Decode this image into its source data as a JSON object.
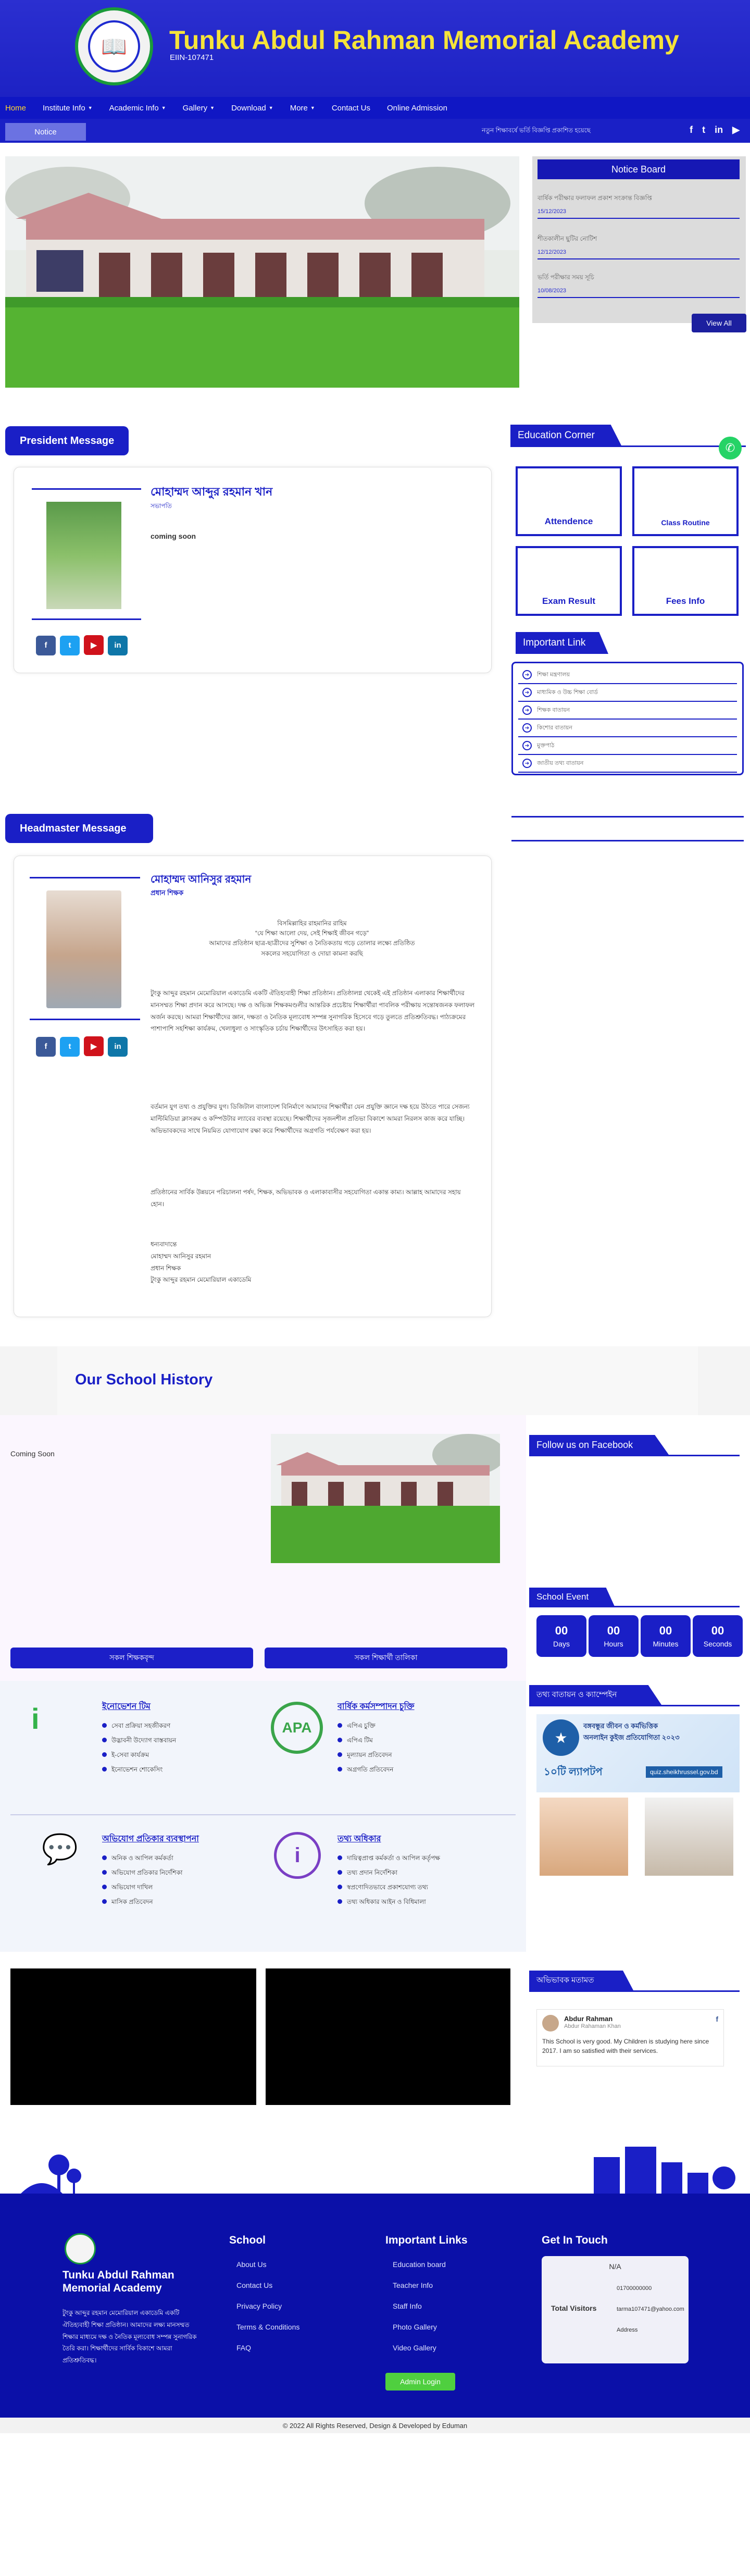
{
  "header": {
    "title": "Tunku Abdul Rahman Memorial Academy",
    "eiin": "EIIN-107471",
    "logo_text": "TUNKU ABDUL RAHMAN MEMORIAL ACADEMY"
  },
  "nav": {
    "items": [
      {
        "label": "Home",
        "active": true,
        "dropdown": false
      },
      {
        "label": "Institute Info",
        "dropdown": true
      },
      {
        "label": "Academic Info",
        "dropdown": true
      },
      {
        "label": "Gallery",
        "dropdown": true
      },
      {
        "label": "Download",
        "dropdown": true
      },
      {
        "label": "More",
        "dropdown": true
      },
      {
        "label": "Contact Us",
        "dropdown": false
      },
      {
        "label": "Online Admission",
        "dropdown": false
      }
    ]
  },
  "notice_bar": {
    "label": "Notice",
    "ticker": "নতুন শিক্ষাবর্ষে ভর্তি বিজ্ঞপ্তি প্রকাশিত হয়েছে",
    "social": [
      "f",
      "t",
      "in",
      "▶"
    ]
  },
  "notice_board": {
    "title": "Notice Board",
    "items": [
      {
        "text": "বার্ষিক পরীক্ষার ফলাফল প্রকাশ সংক্রান্ত বিজ্ঞপ্তি",
        "date": "15/12/2023"
      },
      {
        "text": "শীতকালীন ছুটির নোটিশ",
        "date": "12/12/2023"
      },
      {
        "text": "ভর্তি পরীক্ষার সময় সূচি",
        "date": "10/08/2023"
      }
    ],
    "view_all": "View All"
  },
  "president": {
    "heading": "President Message",
    "name": "মোহাম্মদ আব্দুর রহমান খান",
    "role": "সভাপতি",
    "message": "coming soon"
  },
  "education_corner": {
    "title": "Education Corner",
    "boxes": [
      "Attendence",
      "Class Routine",
      "Exam Result",
      "Fees Info"
    ]
  },
  "important_link": {
    "title": "Important Link",
    "items": [
      "শিক্ষা মন্ত্রণালয়",
      "মাধ্যমিক ও উচ্চ শিক্ষা বোর্ড",
      "শিক্ষক বাতায়ন",
      "কিশোর বাতায়ন",
      "মুক্তপাঠ",
      "জাতীয় তথ্য বাতায়ন"
    ]
  },
  "headmaster": {
    "heading": "Headmaster Message",
    "name": "মোহাম্মদ আনিসুর রহমান",
    "role": "প্রধান শিক্ষক",
    "greet1": "বিসমিল্লাহির রাহমানির রাহিম",
    "greet2": "“যে শিক্ষা আলো দেয়, সেই শিক্ষাই জীবন গড়ে”",
    "greet3": "আমাদের প্রতিষ্ঠান ছাত্র-ছাত্রীদের সুশিক্ষা ও নৈতিকতায় গড়ে তোলার লক্ষ্যে প্রতিষ্ঠিত",
    "greet4": "সকলের সহযোগিতা ও দোয়া কামনা করছি",
    "p1": "টুংকু আব্দুর রহমান মেমোরিয়াল একাডেমি একটি ঐতিহ্যবাহী শিক্ষা প্রতিষ্ঠান। প্রতিষ্ঠালগ্ন থেকেই এই প্রতিষ্ঠান এলাকার শিক্ষার্থীদের মানসম্মত শিক্ষা প্রদান করে আসছে। দক্ষ ও অভিজ্ঞ শিক্ষকমণ্ডলীর আন্তরিক প্রচেষ্টায় শিক্ষার্থীরা পাবলিক পরীক্ষায় সন্তোষজনক ফলাফল অর্জন করছে। আমরা শিক্ষার্থীদের জ্ঞান, দক্ষতা ও নৈতিক মূল্যবোধ সম্পন্ন সুনাগরিক হিসেবে গড়ে তুলতে প্রতিশ্রুতিবদ্ধ। পাঠ্যক্রমের পাশাপাশি সহশিক্ষা কার্যক্রম, খেলাধুলা ও সাংস্কৃতিক চর্চায় শিক্ষার্থীদের উৎসাহিত করা হয়।",
    "p2": "বর্তমান যুগ তথ্য ও প্রযুক্তির যুগ। ডিজিটাল বাংলাদেশ বিনির্মাণে আমাদের শিক্ষার্থীরা যেন প্রযুক্তি জ্ঞানে দক্ষ হয়ে উঠতে পারে সেজন্য মাল্টিমিডিয়া ক্লাসরুম ও কম্পিউটার ল্যাবের ব্যবস্থা রয়েছে। শিক্ষার্থীদের সৃজনশীল প্রতিভা বিকাশে আমরা নিরলস কাজ করে যাচ্ছি। অভিভাবকদের সাথে নিয়মিত যোগাযোগ রক্ষা করে শিক্ষার্থীদের অগ্রগতি পর্যবেক্ষণ করা হয়।",
    "p3": "প্রতিষ্ঠানের সার্বিক উন্নয়নে পরিচালনা পর্ষদ, শিক্ষক, অভিভাবক ও এলাকাবাসীর সহযোগিতা একান্ত কাম্য। আল্লাহ আমাদের সহায় হোন।",
    "sign1": "ধন্যবাদান্তে",
    "sign2": "মোহাম্মদ আনিসুর রহমান",
    "sign3": "প্রধান শিক্ষক",
    "sign4": "টুংকু আব্দুর রহমান মেমোরিয়াল একাডেমি"
  },
  "history": {
    "heading": "Our School History",
    "text": "Coming Soon"
  },
  "facebook": {
    "title": "Follow us on Facebook"
  },
  "school_event": {
    "title": "School Event",
    "countdown": [
      {
        "value": "00",
        "label": "Days"
      },
      {
        "value": "00",
        "label": "Hours"
      },
      {
        "value": "00",
        "label": "Minutes"
      },
      {
        "value": "00",
        "label": "Seconds"
      }
    ]
  },
  "buttons": {
    "left": "সকল শিক্ষকবৃন্দ",
    "right": "সকল শিক্ষার্থী তালিকা"
  },
  "services": [
    {
      "title": "ইনোভেশন টিম",
      "items": [
        "সেবা প্রক্রিয়া সহজীকরণ",
        "উদ্ভাবনী উদ্যোগ বাস্তবায়ন",
        "ই-সেবা কার্যক্রম",
        "ইনোভেশন শোকেসিং"
      ]
    },
    {
      "title": "বার্ষিক কর্মসম্পাদন চুক্তি",
      "items": [
        "এপিএ চুক্তি",
        "এপিএ টিম",
        "মূল্যায়ন প্রতিবেদন",
        "অগ্রগতি প্রতিবেদন"
      ]
    },
    {
      "title": "অভিযোগ প্রতিকার ব্যবস্থাপনা",
      "items": [
        "অনিক ও আপিল কর্মকর্তা",
        "অভিযোগ প্রতিকার নির্দেশিকা",
        "অভিযোগ দাখিল",
        "মাসিক প্রতিবেদন"
      ]
    },
    {
      "title": "তথ্য অধিকার",
      "items": [
        "দায়িত্বপ্রাপ্ত কর্মকর্তা ও আপিল কর্তৃপক্ষ",
        "তথ্য প্রদান নির্দেশিকা",
        "স্বপ্রণোদিতভাবে প্রকাশযোগ্য তথ্য",
        "তথ্য অধিকার আইন ও বিধিমালা"
      ]
    }
  ],
  "campaign": {
    "title": "তথ্য বাতায়ন ও ক্যাম্পেইন",
    "banner_title": "বঙ্গবন্ধুর জীবন ও কর্মভিত্তিক",
    "banner_sub": "অনলাইন কুইজ প্রতিযোগিতা ২০২৩",
    "prize": "১০টি ল্যাপটপ",
    "url": "quiz.sheikhrussel.gov.bd"
  },
  "testimonial": {
    "title": "অভিভাবক মতামত",
    "name": "Abdur Rahman",
    "handle": "Abdur Rahaman Khan",
    "text": "This School is very good. My Children is studying here since 2017. I am so satisfied with their services."
  },
  "footer": {
    "name": "Tunku Abdul Rahman Memorial Academy",
    "about": "টুংকু আব্দুর রহমান মেমোরিয়াল একাডেমি একটি ঐতিহ্যবাহী শিক্ষা প্রতিষ্ঠান। আমাদের লক্ষ্য মানসম্মত শিক্ষার মাধ্যমে দক্ষ ও নৈতিক মূল্যবোধ সম্পন্ন সুনাগরিক তৈরি করা। শিক্ষার্থীদের সার্বিক বিকাশে আমরা প্রতিশ্রুতিবদ্ধ।",
    "school_title": "School",
    "school_links": [
      "About Us",
      "Contact Us",
      "Privacy Policy",
      "Terms & Conditions",
      "FAQ"
    ],
    "imp_title": "Important Links",
    "imp_links": [
      "Education board",
      "Teacher Info",
      "Staff Info",
      "Photo Gallery",
      "Video Gallery"
    ],
    "admin_login": "Admin Login",
    "contact_title": "Get In Touch",
    "visitors_label": "Total Visitors",
    "visitors_value": "N/A",
    "phone": "01700000000",
    "email": "tarma107471@yahoo.com",
    "address": "Address",
    "copyright": "© 2022 All Rights Reserved, Design & Developed by Eduman"
  },
  "colors": {
    "primary": "#1a1fc6",
    "title_yellow": "#f5e33a",
    "footer_bg": "#0b10a8"
  }
}
